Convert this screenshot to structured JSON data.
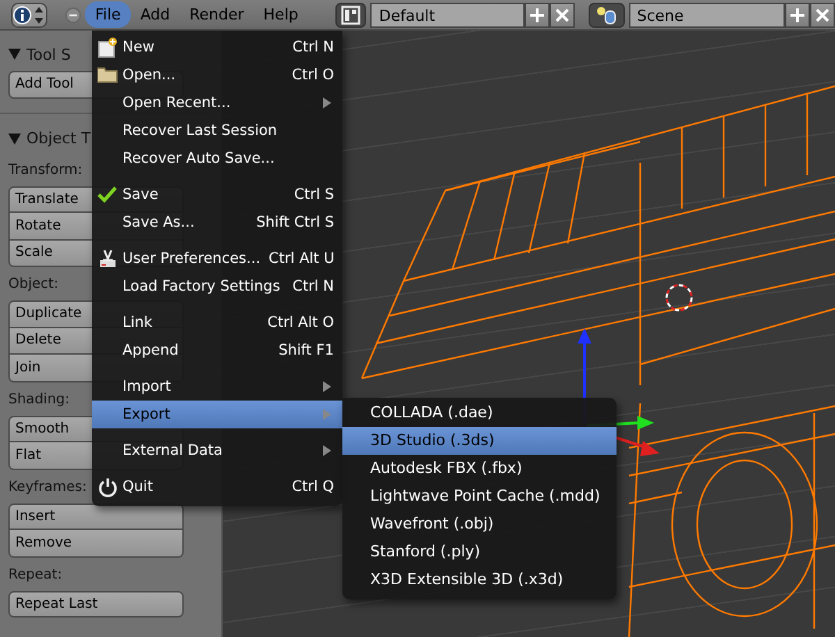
{
  "header": {
    "menus": [
      {
        "label": "File",
        "selected": true
      },
      {
        "label": "Add",
        "selected": false
      },
      {
        "label": "Render",
        "selected": false
      },
      {
        "label": "Help",
        "selected": false
      }
    ],
    "screen_layout": "Default",
    "scene": "Scene"
  },
  "tool_shelf": {
    "title": "Tool S",
    "add_tool": "Add Tool"
  },
  "object_tools": {
    "title": "Object T",
    "groups": [
      {
        "label": "Transform:",
        "buttons": [
          "Translate",
          "Rotate",
          "Scale"
        ]
      },
      {
        "label": "Object:",
        "buttons": [
          "Duplicate",
          "Delete",
          "Join"
        ]
      },
      {
        "label": "Shading:",
        "buttons": [
          "Smooth",
          "Flat"
        ]
      },
      {
        "label": "Keyframes:",
        "buttons": [
          "Insert",
          "Remove"
        ]
      },
      {
        "label": "Repeat:",
        "buttons": [
          "Repeat Last"
        ]
      }
    ]
  },
  "file_menu": {
    "sections": [
      [
        {
          "kind": "new",
          "label": "New",
          "shortcut": "Ctrl N",
          "submenu": false,
          "selected": false
        },
        {
          "kind": "open",
          "label": "Open...",
          "shortcut": "Ctrl O",
          "submenu": false,
          "selected": false
        },
        {
          "kind": "plain",
          "label": "Open Recent...",
          "submenu": true,
          "selected": false
        },
        {
          "kind": "plain",
          "label": "Recover Last Session",
          "submenu": false,
          "selected": false
        },
        {
          "kind": "plain",
          "label": "Recover Auto Save...",
          "submenu": false,
          "selected": false
        }
      ],
      [
        {
          "kind": "check",
          "label": "Save",
          "shortcut": "Ctrl S",
          "submenu": false,
          "selected": false
        },
        {
          "kind": "plain",
          "label": "Save As...",
          "shortcut": "Shift Ctrl S",
          "submenu": false,
          "selected": false
        }
      ],
      [
        {
          "kind": "prefs",
          "label": "User Preferences...",
          "shortcut": "Ctrl Alt U",
          "submenu": false,
          "selected": false
        },
        {
          "kind": "plain",
          "label": "Load Factory Settings",
          "shortcut": "Ctrl N",
          "submenu": false,
          "selected": false
        }
      ],
      [
        {
          "kind": "plain",
          "label": "Link",
          "shortcut": "Ctrl Alt O",
          "submenu": false,
          "selected": false
        },
        {
          "kind": "plain",
          "label": "Append",
          "shortcut": "Shift F1",
          "submenu": false,
          "selected": false
        }
      ],
      [
        {
          "kind": "plain",
          "label": "Import",
          "submenu": true,
          "selected": false
        },
        {
          "kind": "plain",
          "label": "Export",
          "submenu": true,
          "selected": true
        }
      ],
      [
        {
          "kind": "plain",
          "label": "External Data",
          "submenu": true,
          "selected": false
        }
      ],
      [
        {
          "kind": "power",
          "label": "Quit",
          "shortcut": "Ctrl Q",
          "submenu": false,
          "selected": false
        }
      ]
    ]
  },
  "export_menu": {
    "items": [
      {
        "label": "COLLADA (.dae)",
        "selected": false
      },
      {
        "label": "3D Studio (.3ds)",
        "selected": true
      },
      {
        "label": "Autodesk FBX (.fbx)",
        "selected": false
      },
      {
        "label": "Lightwave Point Cache (.mdd)",
        "selected": false
      },
      {
        "label": "Wavefront (.obj)",
        "selected": false
      },
      {
        "label": "Stanford (.ply)",
        "selected": false
      },
      {
        "label": "X3D Extensible 3D (.x3d)",
        "selected": false
      }
    ]
  }
}
